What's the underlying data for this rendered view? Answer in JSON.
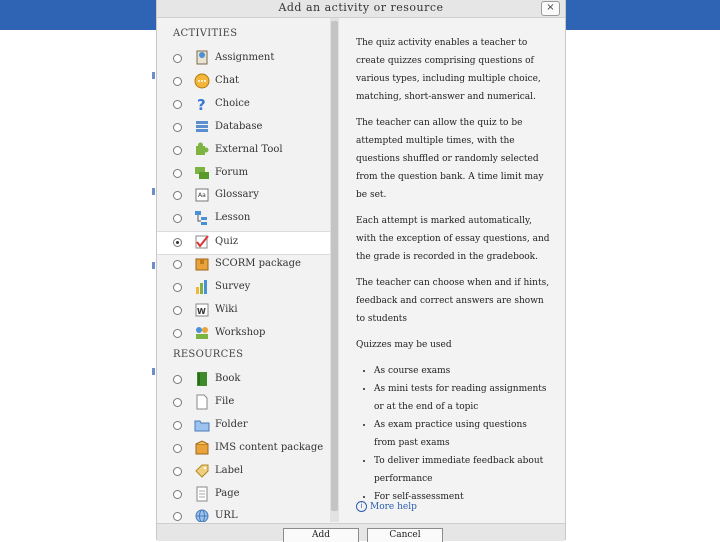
{
  "dialog": {
    "title": "Add an activity or resource",
    "close_label": "×"
  },
  "list": {
    "activities_heading": "ACTIVITIES",
    "resources_heading": "RESOURCES",
    "activities": [
      {
        "label": "Assignment",
        "icon": "assignment-icon",
        "selected": false
      },
      {
        "label": "Chat",
        "icon": "chat-icon",
        "selected": false
      },
      {
        "label": "Choice",
        "icon": "choice-icon",
        "selected": false
      },
      {
        "label": "Database",
        "icon": "database-icon",
        "selected": false
      },
      {
        "label": "External Tool",
        "icon": "puzzle-icon",
        "selected": false
      },
      {
        "label": "Forum",
        "icon": "forum-icon",
        "selected": false
      },
      {
        "label": "Glossary",
        "icon": "glossary-icon",
        "selected": false
      },
      {
        "label": "Lesson",
        "icon": "lesson-icon",
        "selected": false
      },
      {
        "label": "Quiz",
        "icon": "quiz-icon",
        "selected": true
      },
      {
        "label": "SCORM package",
        "icon": "scorm-icon",
        "selected": false
      },
      {
        "label": "Survey",
        "icon": "survey-icon",
        "selected": false
      },
      {
        "label": "Wiki",
        "icon": "wiki-icon",
        "selected": false
      },
      {
        "label": "Workshop",
        "icon": "workshop-icon",
        "selected": false
      }
    ],
    "resources": [
      {
        "label": "Book",
        "icon": "book-icon",
        "selected": false
      },
      {
        "label": "File",
        "icon": "file-icon",
        "selected": false
      },
      {
        "label": "Folder",
        "icon": "folder-icon",
        "selected": false
      },
      {
        "label": "IMS content package",
        "icon": "package-icon",
        "selected": false
      },
      {
        "label": "Label",
        "icon": "label-icon",
        "selected": false
      },
      {
        "label": "Page",
        "icon": "page-icon",
        "selected": false
      },
      {
        "label": "URL",
        "icon": "url-icon",
        "selected": false
      }
    ]
  },
  "description": {
    "paragraphs": [
      "The quiz activity enables a teacher to create quizzes comprising questions of various types, including multiple choice, matching, short-answer and numerical.",
      "The teacher can allow the quiz to be attempted multiple times, with the questions shuffled or randomly selected from the question bank. A time limit may be set.",
      "Each attempt is marked automatically, with the exception of essay questions, and the grade is recorded in the gradebook.",
      "The teacher can choose when and if hints, feedback and correct answers are shown to students",
      "Quizzes may be used"
    ],
    "uses": [
      "As course exams",
      "As mini tests for reading assignments or at the end of a topic",
      "As exam practice using questions from past exams",
      "To deliver immediate feedback about performance",
      "For self-assessment"
    ],
    "more_help": "More help",
    "help_icon_glyph": "i"
  },
  "footer": {
    "add_label": "Add",
    "cancel_label": "Cancel"
  },
  "colors": {
    "background_band": "#2f64b5",
    "link": "#2a5db0"
  }
}
